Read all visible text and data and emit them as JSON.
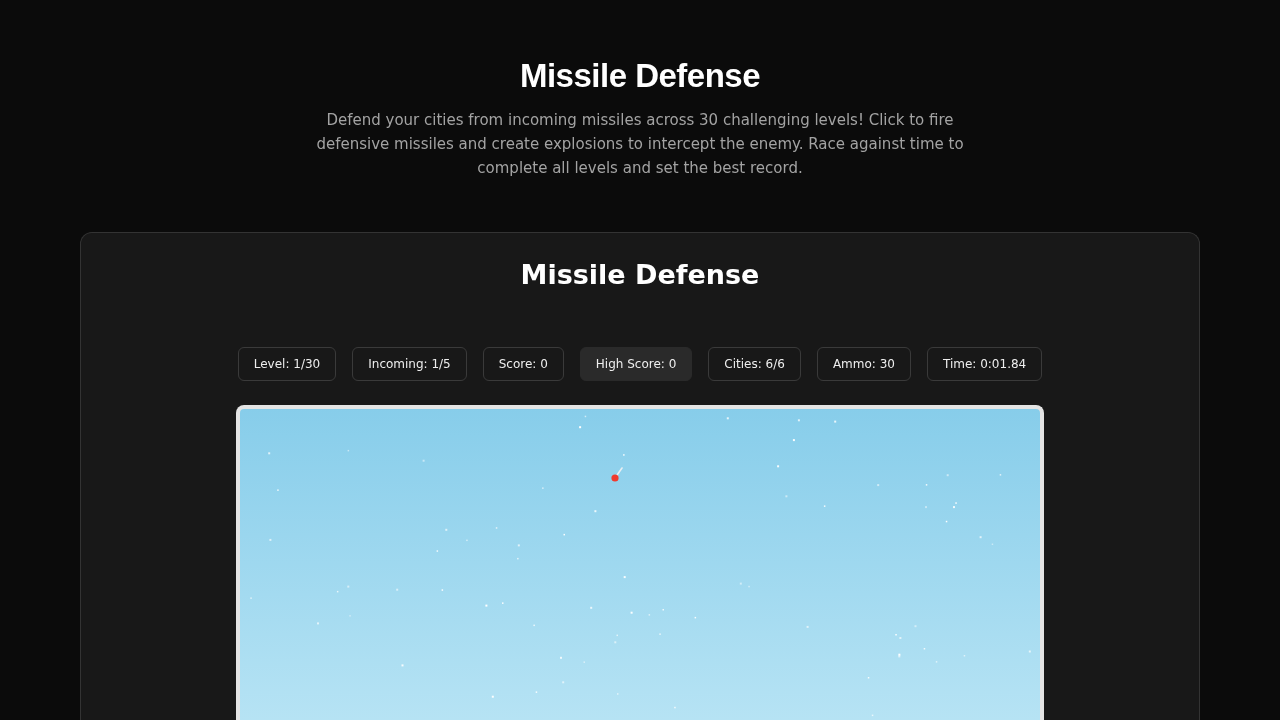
{
  "header": {
    "title": "Missile Defense",
    "description": "Defend your cities from incoming missiles across 30 challenging levels! Click to fire defensive missiles and create explosions to intercept the enemy. Race against time to complete all levels and set the best record."
  },
  "game": {
    "title": "Missile Defense",
    "stats": [
      {
        "label": "Level: 1/30",
        "highlighted": false
      },
      {
        "label": "Incoming: 1/5",
        "highlighted": false
      },
      {
        "label": "Score: 0",
        "highlighted": false
      },
      {
        "label": "High Score: 0",
        "highlighted": true
      },
      {
        "label": "Cities: 6/6",
        "highlighted": false
      },
      {
        "label": "Ammo: 30",
        "highlighted": false
      },
      {
        "label": "Time: 0:01.84",
        "highlighted": false
      }
    ]
  }
}
